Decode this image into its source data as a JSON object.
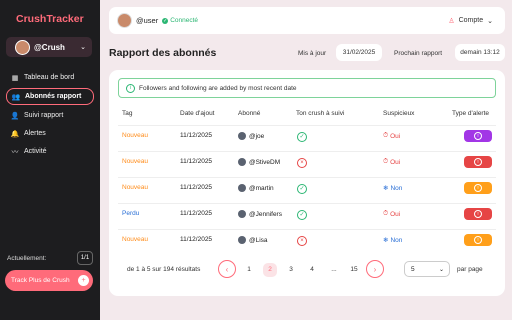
{
  "app": {
    "brand": "CrushTracker"
  },
  "sidebar": {
    "profile_name": "@Crush",
    "nav": [
      {
        "label": "Tableau de bord",
        "icon": "grid-icon",
        "active": false
      },
      {
        "label": "Abonnés rapport",
        "icon": "users-icon",
        "active": true
      },
      {
        "label": "Suivi rapport",
        "icon": "user-icon",
        "active": false
      },
      {
        "label": "Alertes",
        "icon": "bell-icon",
        "active": false
      },
      {
        "label": "Activité",
        "icon": "activity-icon",
        "active": false
      }
    ],
    "actuel_label": "Actuellement:",
    "actuel_count": "1/1",
    "track_button": "Track Plus de Crush"
  },
  "topbar": {
    "username": "@user",
    "status": "Connecté",
    "account": "Compte"
  },
  "header": {
    "title": "Rapport des abonnés",
    "maj_label": "Mis à jour",
    "maj_value": "31/02/2025",
    "proch_label": "Prochain rapport",
    "proch_value": "demain 13:12"
  },
  "info_banner": "Followers and following are added by most recent date",
  "table": {
    "headers": [
      "Tag",
      "Date d'ajout",
      "Abonné",
      "Ton crush à suivi",
      "Suspicieux",
      "Type d'alerte"
    ],
    "rows": [
      {
        "tag": "Nouveau",
        "date": "11/12/2025",
        "account": "@joe",
        "crush_follows": true,
        "suspicious": "Oui",
        "alert_color": "#a236e6"
      },
      {
        "tag": "Nouveau",
        "date": "11/12/2025",
        "account": "@StiveDM",
        "crush_follows": false,
        "suspicious": "Oui",
        "alert_color": "#e64545"
      },
      {
        "tag": "Nouveau",
        "date": "11/12/2025",
        "account": "@martin",
        "crush_follows": true,
        "suspicious": "Non",
        "alert_color": "#ff9f1a"
      },
      {
        "tag": "Perdu",
        "date": "11/12/2025",
        "account": "@Jennifers",
        "crush_follows": true,
        "suspicious": "Oui",
        "alert_color": "#e64545"
      },
      {
        "tag": "Nouveau",
        "date": "11/12/2025",
        "account": "@Lisa",
        "crush_follows": false,
        "suspicious": "Non",
        "alert_color": "#ff9f1a"
      }
    ]
  },
  "pagination": {
    "info": "de 1 à 5 sur 194 résultats",
    "pages": [
      "1",
      "2",
      "3",
      "4",
      "...",
      "15"
    ],
    "active_page": "2",
    "per_page": "5",
    "per_page_label": "par page"
  },
  "colors": {
    "accent": "#ff6b7a",
    "sidebar_bg": "#1d1d1f",
    "page_bg": "#f3e9ec"
  }
}
